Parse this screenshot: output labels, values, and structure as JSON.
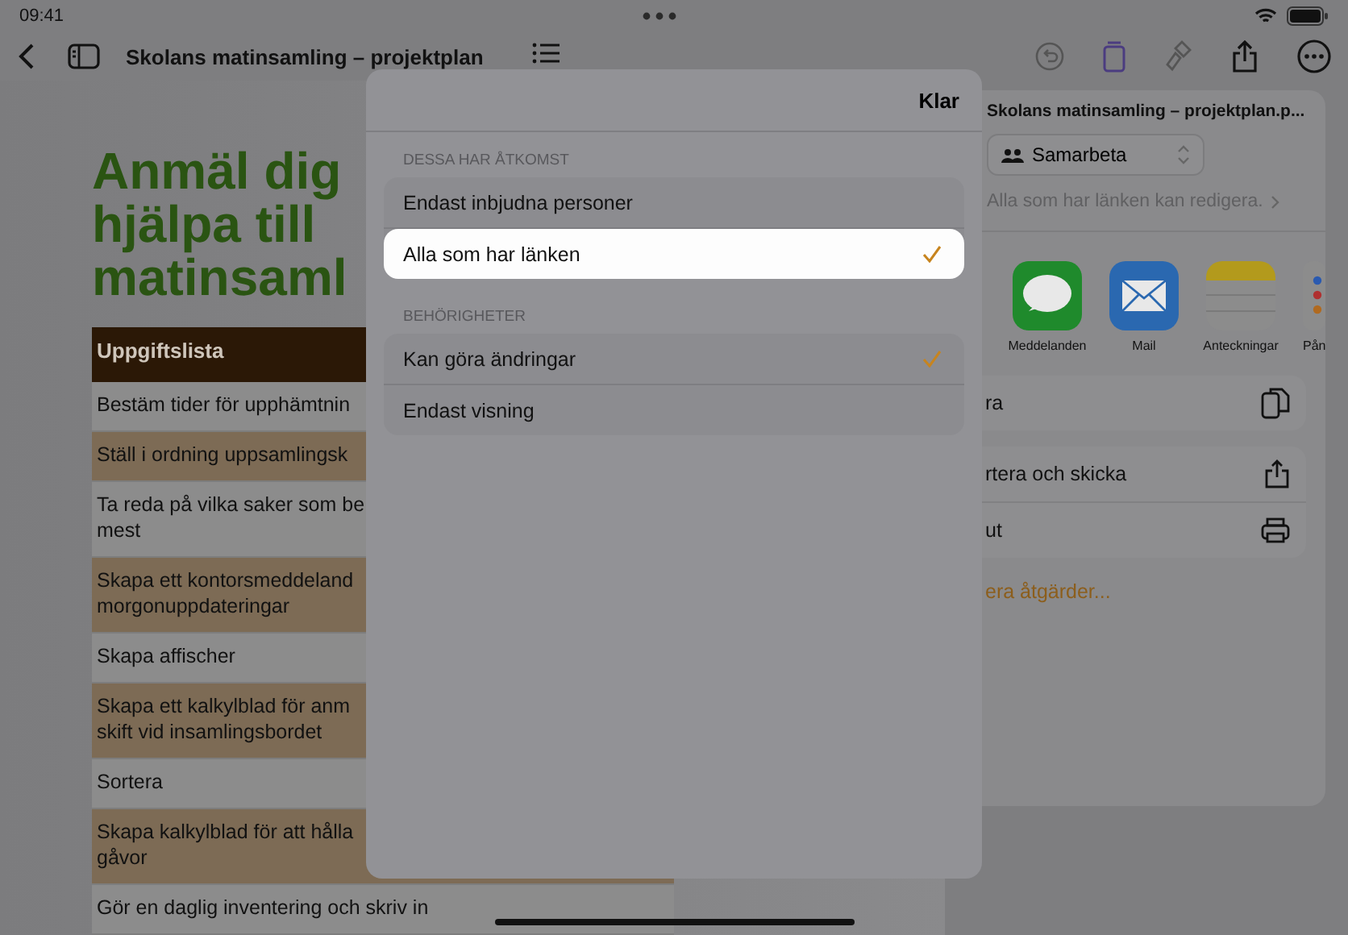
{
  "status_bar": {
    "time": "09:41"
  },
  "toolbar": {
    "title": "Skolans matinsamling – projektplan"
  },
  "document": {
    "heading_lines": [
      "Anmäl dig",
      "hjälpa till",
      "matinsaml"
    ],
    "table": {
      "header": "Uppgiftslista",
      "rows": [
        {
          "lines": [
            "Bestäm tider för upphämtnin"
          ],
          "shaded": false
        },
        {
          "lines": [
            "Ställ i ordning uppsamlingsk"
          ],
          "shaded": true
        },
        {
          "lines": [
            "Ta reda på vilka saker som be",
            "mest"
          ],
          "shaded": false
        },
        {
          "lines": [
            "Skapa ett kontorsmeddeland",
            "morgonuppdateringar"
          ],
          "shaded": true
        },
        {
          "lines": [
            "Skapa affischer"
          ],
          "shaded": false
        },
        {
          "lines": [
            "Skapa ett kalkylblad för anm",
            "skift vid insamlingsbordet"
          ],
          "shaded": true
        },
        {
          "lines": [
            "Sortera"
          ],
          "shaded": false
        },
        {
          "lines": [
            "Skapa kalkylblad för att hålla",
            "gåvor"
          ],
          "shaded": true
        },
        {
          "lines": [
            "Gör en daglig inventering och skriv in"
          ],
          "shaded": false
        }
      ]
    }
  },
  "share_sheet": {
    "title": "Skolans matinsamling – projektplan.p...",
    "mode": "Samarbeta",
    "access_note": "Alla som har länken kan redigera.",
    "apps": [
      {
        "kind": "messages",
        "label": "Meddelanden"
      },
      {
        "kind": "mail",
        "label": "Mail"
      },
      {
        "kind": "notes",
        "label": "Anteckningar"
      },
      {
        "kind": "reminders",
        "label": "Pån"
      }
    ],
    "action_groups": [
      [
        {
          "label": "ra",
          "kind": "copy"
        }
      ],
      [
        {
          "label": "rtera och skicka",
          "kind": "export"
        },
        {
          "label": "ut",
          "kind": "print"
        }
      ]
    ],
    "more_link": "era åtgärder..."
  },
  "popover": {
    "done": "Klar",
    "sections": [
      {
        "header": "DESSA HAR ÅTKOMST",
        "options": [
          {
            "label": "Endast inbjudna personer",
            "selected": false,
            "highlighted": false
          },
          {
            "label": "Alla som har länken",
            "selected": true,
            "highlighted": true
          }
        ]
      },
      {
        "header": "BEHÖRIGHETER",
        "options": [
          {
            "label": "Kan göra ändringar",
            "selected": true,
            "highlighted": false
          },
          {
            "label": "Endast visning",
            "selected": false,
            "highlighted": false
          }
        ]
      }
    ]
  }
}
